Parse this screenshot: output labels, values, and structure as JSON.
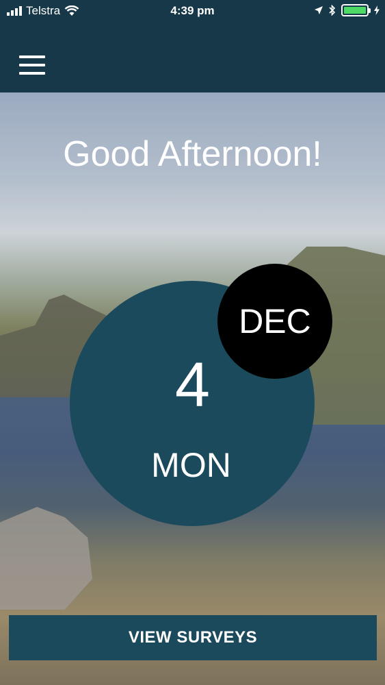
{
  "status_bar": {
    "carrier": "Telstra",
    "time": "4:39 pm",
    "battery_level": 1.0
  },
  "header": {
    "menu_icon": "hamburger-menu-icon"
  },
  "greeting": "Good Afternoon!",
  "date": {
    "month": "DEC",
    "day": "4",
    "weekday": "MON"
  },
  "actions": {
    "view_surveys_label": "VIEW SURVEYS"
  },
  "colors": {
    "header_bg": "#173848",
    "circle_bg": "#1b4a5c",
    "month_bg": "#000000",
    "battery": "#4cd964"
  }
}
